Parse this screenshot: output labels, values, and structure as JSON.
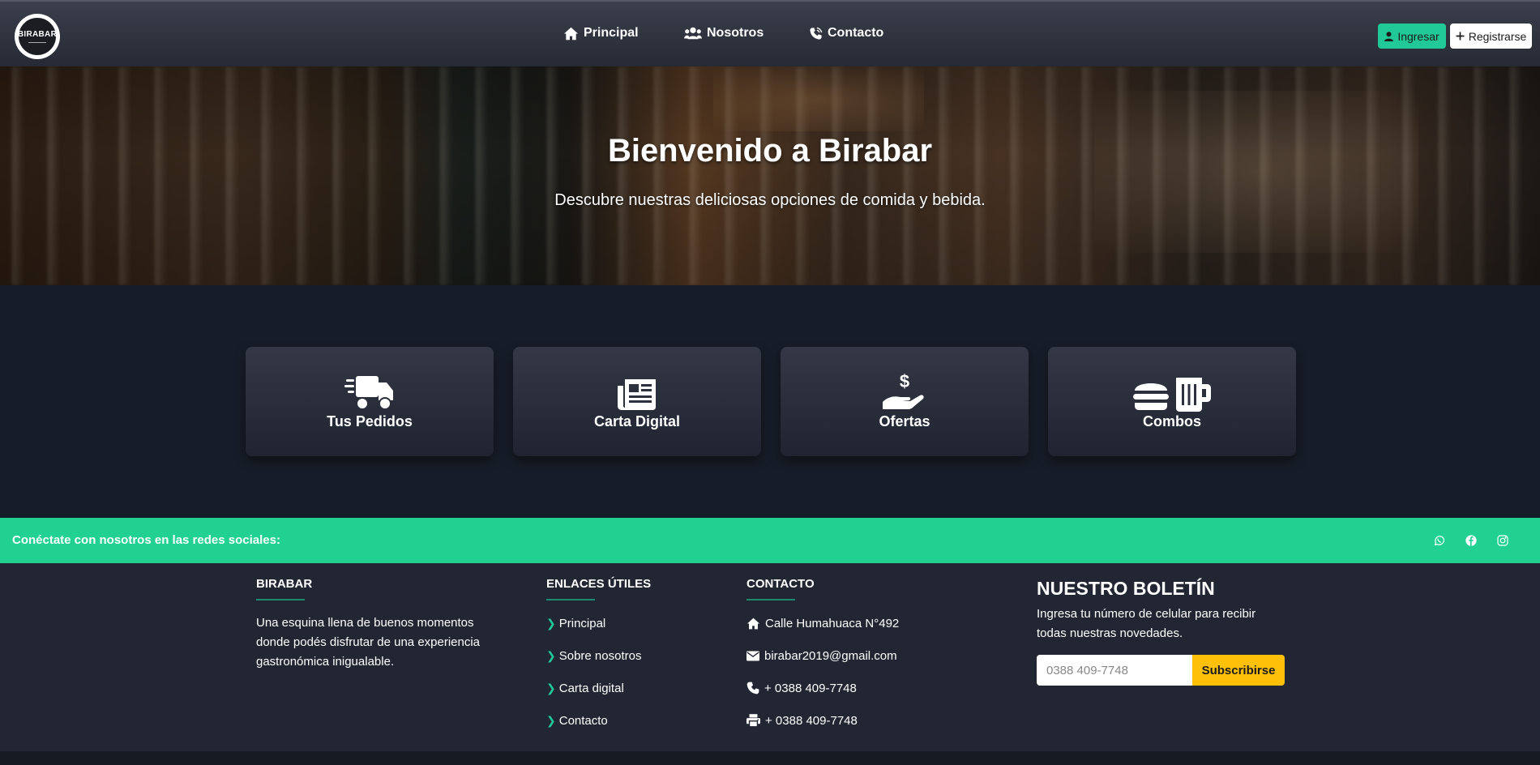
{
  "brand": {
    "logo_text": "BIRABAR"
  },
  "nav": {
    "items": [
      {
        "label": "Principal",
        "icon": "home-icon"
      },
      {
        "label": "Nosotros",
        "icon": "users-icon"
      },
      {
        "label": "Contacto",
        "icon": "phone-icon"
      }
    ],
    "login_label": "Ingresar",
    "register_label": "Registrarse"
  },
  "hero": {
    "title": "Bienvenido a Birabar",
    "subtitle": "Descubre nuestras deliciosas opciones de comida y bebida."
  },
  "cards": [
    {
      "label": "Tus Pedidos",
      "icon": "delivery-truck-icon"
    },
    {
      "label": "Carta Digital",
      "icon": "newspaper-icon"
    },
    {
      "label": "Ofertas",
      "icon": "hand-dollar-icon"
    },
    {
      "label": "Combos",
      "icon": "burger-beer-icon"
    }
  ],
  "social": {
    "text": "Conéctate con nosotros en las redes sociales:",
    "icons": [
      "whatsapp-icon",
      "facebook-icon",
      "instagram-icon"
    ]
  },
  "footer": {
    "about": {
      "title": "BIRABAR",
      "text": "Una esquina llena de buenos momentos donde podés disfrutar de una experiencia gastronómica inigualable."
    },
    "links": {
      "title": "ENLACES ÚTILES",
      "items": [
        "Principal",
        "Sobre nosotros",
        "Carta digital",
        "Contacto"
      ]
    },
    "contact": {
      "title": "CONTACTO",
      "address": "Calle Humahuaca N°492",
      "email": "birabar2019@gmail.com",
      "phone": "+ 0388 409-7748",
      "fax": "+ 0388 409-7748"
    },
    "newsletter": {
      "title": "NUESTRO BOLETÍN",
      "text": "Ingresa tu número de celular para recibir todas nuestras novedades.",
      "placeholder": "0388 409-7748",
      "button_label": "Subscribirse"
    }
  },
  "colors": {
    "accent": "#20c997",
    "social_bar": "#20d192",
    "subscribe_button": "#ffc107",
    "page_background": "#171d28",
    "footer_background": "#212632"
  }
}
